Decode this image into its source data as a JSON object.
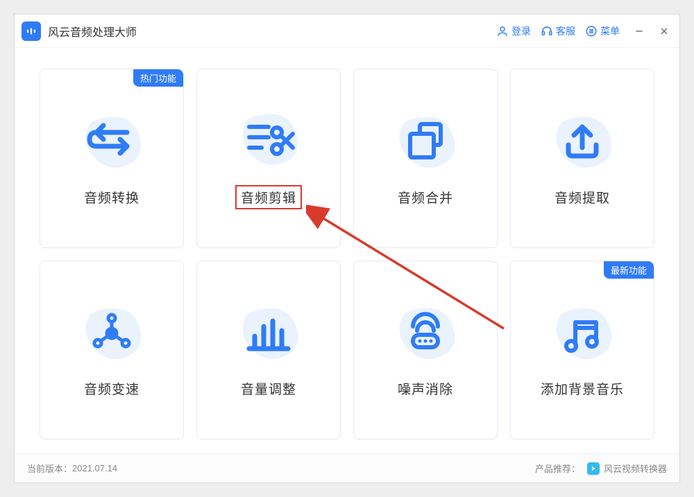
{
  "app": {
    "title": "风云音频处理大师"
  },
  "titlebar": {
    "login": "登录",
    "service": "客服",
    "menu": "菜单"
  },
  "badges": {
    "hot": "热门功能",
    "new": "最新功能"
  },
  "cards": [
    {
      "label": "音频转换"
    },
    {
      "label": "音频剪辑"
    },
    {
      "label": "音频合并"
    },
    {
      "label": "音频提取"
    },
    {
      "label": "音频变速"
    },
    {
      "label": "音量调整"
    },
    {
      "label": "噪声消除"
    },
    {
      "label": "添加背景音乐"
    }
  ],
  "footer": {
    "version_label": "当前版本：",
    "version": "2021.07.14",
    "reco_label": "产品推荐：",
    "reco_name": "风云视频转换器"
  }
}
